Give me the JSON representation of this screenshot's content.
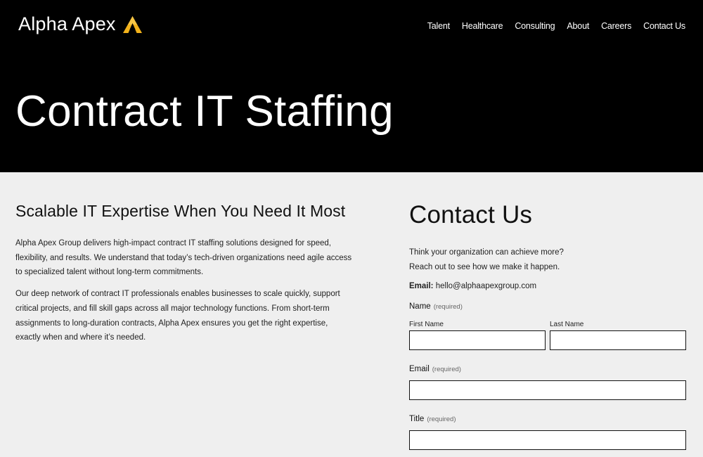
{
  "brand": {
    "name": "Alpha Apex",
    "accent": "#f2b21b"
  },
  "nav": {
    "items": [
      "Talent",
      "Healthcare",
      "Consulting",
      "About",
      "Careers",
      "Contact Us"
    ]
  },
  "hero": {
    "title": "Contract IT Staffing"
  },
  "main": {
    "heading": "Scalable IT Expertise When You Need It Most",
    "paragraphs": [
      "Alpha Apex Group delivers high-impact contract IT staffing solutions designed for speed, flexibility, and results. We understand that today’s tech-driven organizations need agile access to specialized talent without long-term commitments.",
      "Our deep network of contract IT professionals enables businesses to scale quickly, support critical projects, and fill skill gaps across all major technology functions. From short-term assignments to long-duration contracts, Alpha Apex ensures you get the right expertise, exactly when and where it’s needed."
    ]
  },
  "contact": {
    "title": "Contact Us",
    "intro_line1": "Think your organization can achieve more?",
    "intro_line2": "Reach out to see how we make it happen.",
    "email_label": "Email:",
    "email_value": "hello@alphaapexgroup.com",
    "required_text": "(required)",
    "name_label": "Name",
    "first_name_label": "First Name",
    "last_name_label": "Last Name",
    "email_field_label": "Email",
    "title_field_label": "Title"
  }
}
